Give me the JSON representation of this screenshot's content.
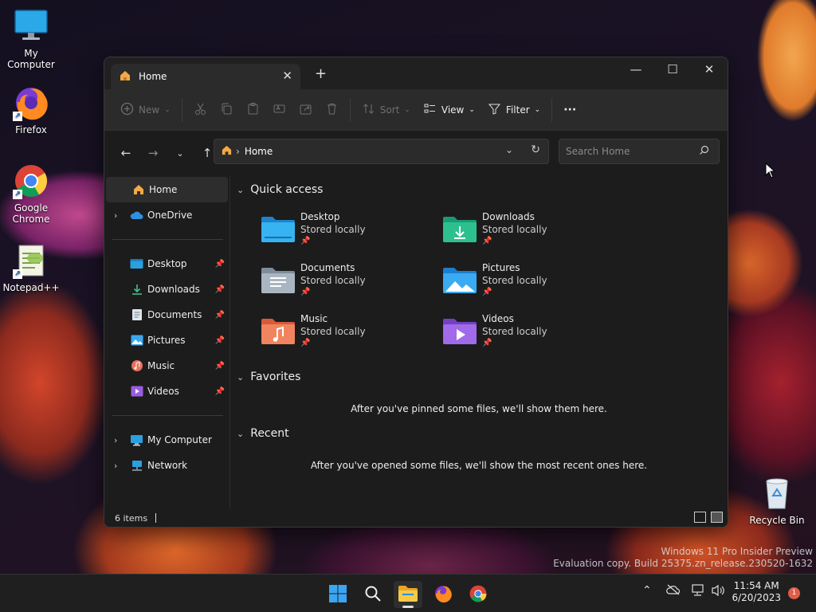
{
  "desktop": {
    "icons": [
      {
        "label": "My Computer"
      },
      {
        "label": "Firefox"
      },
      {
        "label": "Google Chrome"
      },
      {
        "label": "Notepad++"
      },
      {
        "label": "Recycle Bin"
      }
    ],
    "watermark_line1": "Windows 11 Pro Insider Preview",
    "watermark_line2": "Evaluation copy. Build 25375.zn_release.230520-1632"
  },
  "explorer": {
    "tab_title": "Home",
    "toolbar": {
      "new_label": "New",
      "sort_label": "Sort",
      "view_label": "View",
      "filter_label": "Filter",
      "more_label": "···"
    },
    "address": {
      "crumb": "Home",
      "search_placeholder": "Search Home"
    },
    "sidebar": {
      "items": [
        {
          "label": "Home",
          "icon": "home-icon"
        },
        {
          "label": "OneDrive",
          "icon": "onedrive-icon"
        },
        {
          "label": "Desktop",
          "icon": "desktop-folder-icon"
        },
        {
          "label": "Downloads",
          "icon": "downloads-folder-icon"
        },
        {
          "label": "Documents",
          "icon": "documents-folder-icon"
        },
        {
          "label": "Pictures",
          "icon": "pictures-folder-icon"
        },
        {
          "label": "Music",
          "icon": "music-folder-icon"
        },
        {
          "label": "Videos",
          "icon": "videos-folder-icon"
        },
        {
          "label": "My Computer",
          "icon": "computer-icon"
        },
        {
          "label": "Network",
          "icon": "network-icon"
        }
      ]
    },
    "quick_access": {
      "title": "Quick access",
      "items": [
        {
          "name": "Desktop",
          "sub": "Stored locally"
        },
        {
          "name": "Downloads",
          "sub": "Stored locally"
        },
        {
          "name": "Documents",
          "sub": "Stored locally"
        },
        {
          "name": "Pictures",
          "sub": "Stored locally"
        },
        {
          "name": "Music",
          "sub": "Stored locally"
        },
        {
          "name": "Videos",
          "sub": "Stored locally"
        }
      ]
    },
    "favorites": {
      "title": "Favorites",
      "empty_msg": "After you've pinned some files, we'll show them here."
    },
    "recent": {
      "title": "Recent",
      "empty_msg": "After you've opened some files, we'll show the most recent ones here."
    },
    "status": "6 items"
  },
  "taskbar": {
    "time": "11:54 AM",
    "date": "6/20/2023",
    "notification_count": "1"
  }
}
